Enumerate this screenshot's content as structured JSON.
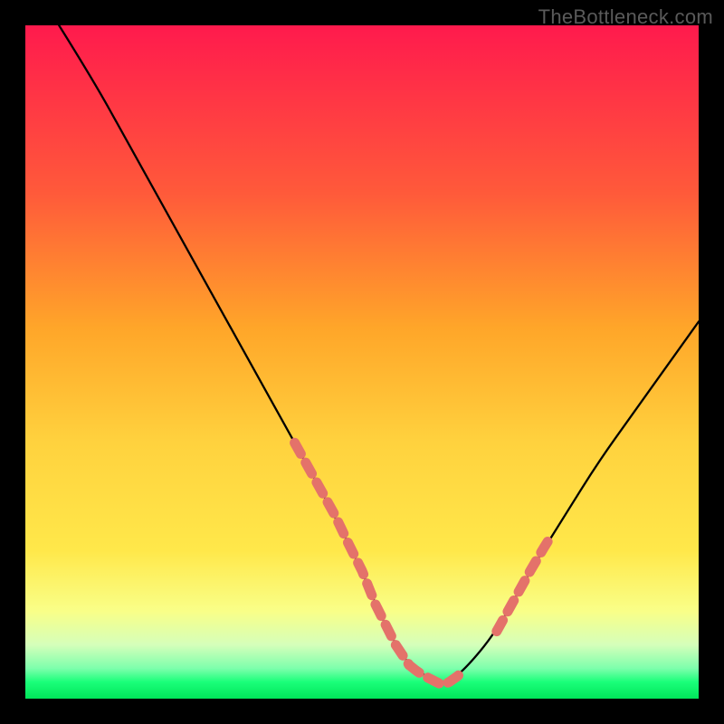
{
  "watermark": "TheBottleneck.com",
  "colors": {
    "background": "#000000",
    "gradient_top": "#ff1a4d",
    "gradient_mid_orange": "#ffa629",
    "gradient_mid_yellow": "#ffe84a",
    "gradient_green": "#1bff7a",
    "curve": "#000000",
    "marker": "#e4726a"
  },
  "chart_data": {
    "type": "line",
    "title": "",
    "xlabel": "",
    "ylabel": "",
    "xlim": [
      0,
      100
    ],
    "ylim": [
      0,
      100
    ],
    "series": [
      {
        "name": "curve",
        "x": [
          5,
          10,
          15,
          20,
          25,
          30,
          35,
          40,
          45,
          50,
          52,
          55,
          57,
          60,
          62,
          65,
          70,
          75,
          80,
          85,
          90,
          95,
          100
        ],
        "y": [
          100,
          92,
          83,
          74,
          65,
          56,
          47,
          38,
          29,
          19,
          14,
          8,
          5,
          3,
          2,
          4,
          10,
          19,
          27,
          35,
          42,
          49,
          56
        ]
      }
    ],
    "markers": {
      "left_segment": [
        {
          "x": 40,
          "y": 38
        },
        {
          "x": 41.5,
          "y": 35.3
        },
        {
          "x": 43,
          "y": 32.6
        },
        {
          "x": 44.5,
          "y": 29.9
        },
        {
          "x": 46,
          "y": 27.2
        },
        {
          "x": 48,
          "y": 23.0
        },
        {
          "x": 49,
          "y": 21.0
        },
        {
          "x": 50,
          "y": 19.0
        },
        {
          "x": 51,
          "y": 16.5
        },
        {
          "x": 52,
          "y": 14.0
        },
        {
          "x": 53,
          "y": 12.0
        },
        {
          "x": 54,
          "y": 10.0
        },
        {
          "x": 55,
          "y": 8.0
        },
        {
          "x": 56,
          "y": 6.5
        },
        {
          "x": 57,
          "y": 5.0
        }
      ],
      "valley_segment": [
        {
          "x": 57,
          "y": 5.0
        },
        {
          "x": 58,
          "y": 4.2
        },
        {
          "x": 59,
          "y": 3.5
        },
        {
          "x": 60,
          "y": 3.0
        },
        {
          "x": 61,
          "y": 2.5
        },
        {
          "x": 62,
          "y": 2.0
        },
        {
          "x": 63,
          "y": 2.5
        },
        {
          "x": 64,
          "y": 3.2
        },
        {
          "x": 65,
          "y": 4.0
        }
      ],
      "right_segment": [
        {
          "x": 70,
          "y": 10.0
        },
        {
          "x": 71,
          "y": 11.8
        },
        {
          "x": 72,
          "y": 13.6
        },
        {
          "x": 73,
          "y": 15.4
        },
        {
          "x": 74,
          "y": 17.2
        },
        {
          "x": 75,
          "y": 19.0
        },
        {
          "x": 76,
          "y": 20.7
        },
        {
          "x": 77,
          "y": 22.4
        },
        {
          "x": 78,
          "y": 24.0
        }
      ]
    }
  }
}
